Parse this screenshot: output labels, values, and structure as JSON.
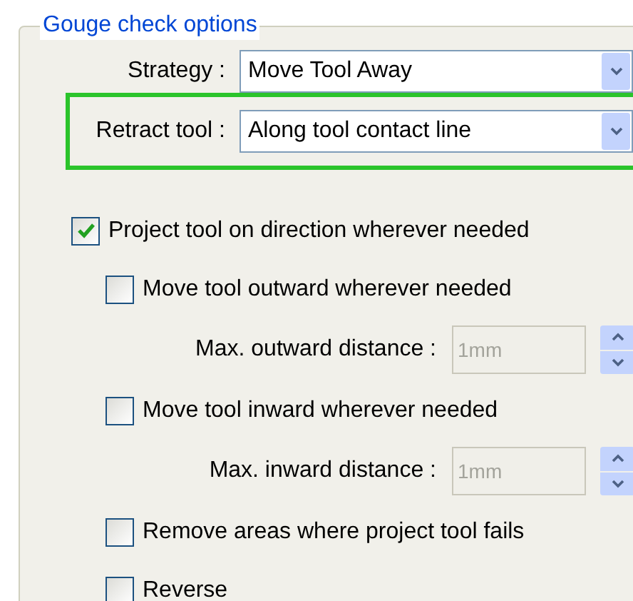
{
  "group": {
    "title": "Gouge check options"
  },
  "dropdowns": [
    {
      "label": "Strategy :",
      "value": "Move Tool Away",
      "highlighted": false
    },
    {
      "label": "Retract tool :",
      "value": "Along tool contact line",
      "highlighted": true
    }
  ],
  "options": [
    {
      "kind": "checkbox",
      "label": "Project tool on direction wherever needed",
      "checked": true,
      "children": [
        {
          "kind": "checkbox",
          "label": "Move tool outward wherever needed",
          "checked": false,
          "children": [
            {
              "kind": "spin",
              "label": "Max. outward distance :",
              "value": "1mm",
              "disabled": true
            }
          ]
        },
        {
          "kind": "checkbox",
          "label": "Move tool inward wherever needed",
          "checked": false,
          "children": [
            {
              "kind": "spin",
              "label": "Max. inward distance :",
              "value": "1mm",
              "disabled": true
            }
          ]
        },
        {
          "kind": "checkbox",
          "label": "Remove areas where project tool fails",
          "checked": false
        },
        {
          "kind": "checkbox",
          "label": "Reverse",
          "checked": false
        }
      ]
    }
  ]
}
